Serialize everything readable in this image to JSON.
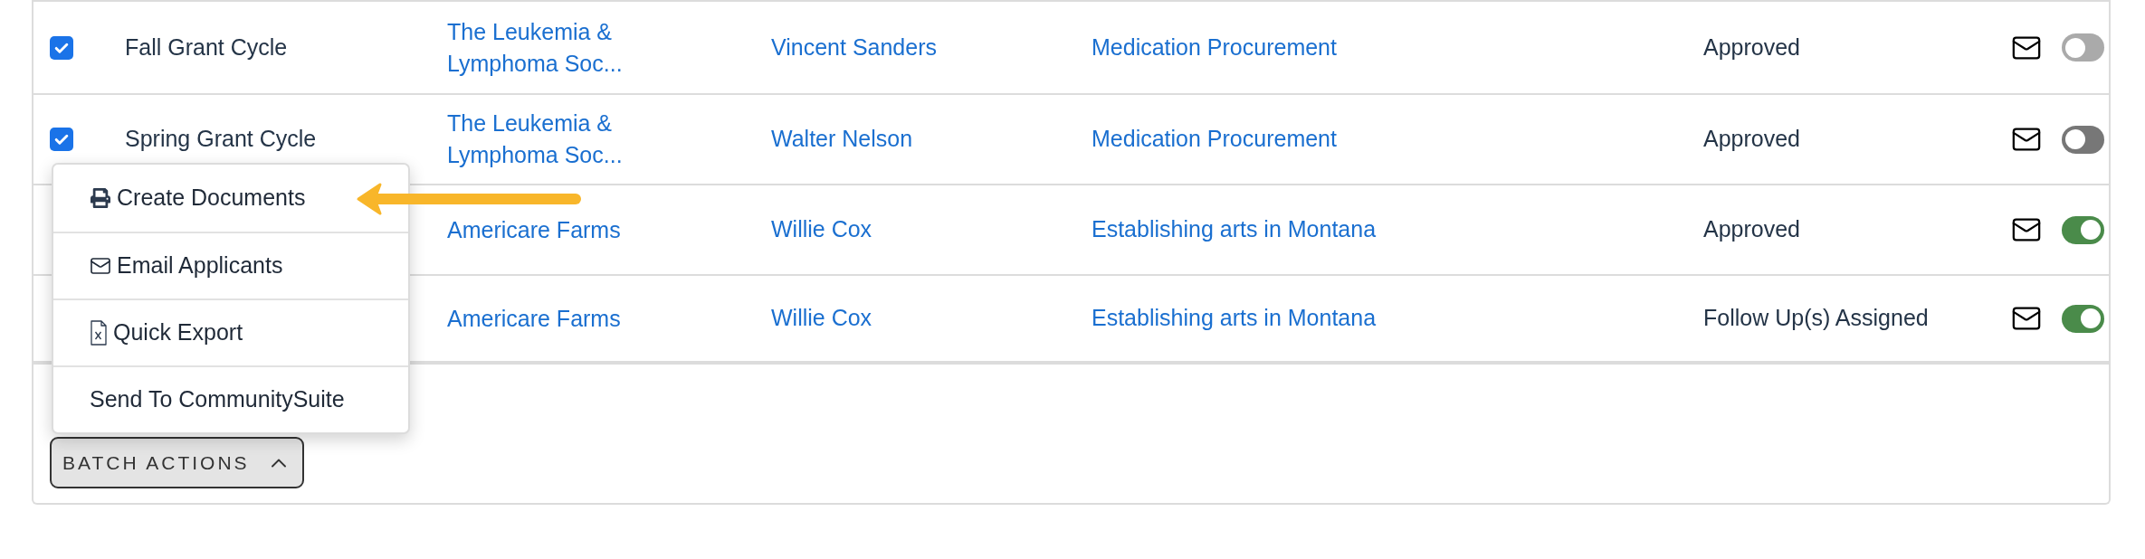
{
  "rows": [
    {
      "checked": true,
      "name": "Fall Grant Cycle",
      "organization": "The Leukemia & Lymphoma Soc...",
      "contact": "Vincent Sanders",
      "project": "Medication Procurement",
      "status": "Approved",
      "toggle": {
        "on": false,
        "disabled": true
      }
    },
    {
      "checked": true,
      "name": "Spring Grant Cycle",
      "organization": "The Leukemia & Lymphoma Soc...",
      "contact": "Walter Nelson",
      "project": "Medication Procurement",
      "status": "Approved",
      "toggle": {
        "on": false,
        "disabled": false
      }
    },
    {
      "organization": "Americare Farms",
      "contact": "Willie Cox",
      "project": "Establishing arts in Montana",
      "status": "Approved",
      "toggle": {
        "on": true
      }
    },
    {
      "organization": "Americare Farms",
      "contact": "Willie Cox",
      "project": "Establishing arts in Montana",
      "status": "Follow Up(s) Assigned",
      "toggle": {
        "on": true
      }
    }
  ],
  "batch_menu": {
    "items": [
      {
        "kind": "print",
        "label": "Create Documents"
      },
      {
        "kind": "email",
        "label": "Email Applicants"
      },
      {
        "kind": "export",
        "label": "Quick Export"
      },
      {
        "kind": "send",
        "label": "Send To CommunitySuite"
      }
    ],
    "expanded": true
  },
  "batch_button": {
    "label": "BATCH ACTIONS"
  }
}
